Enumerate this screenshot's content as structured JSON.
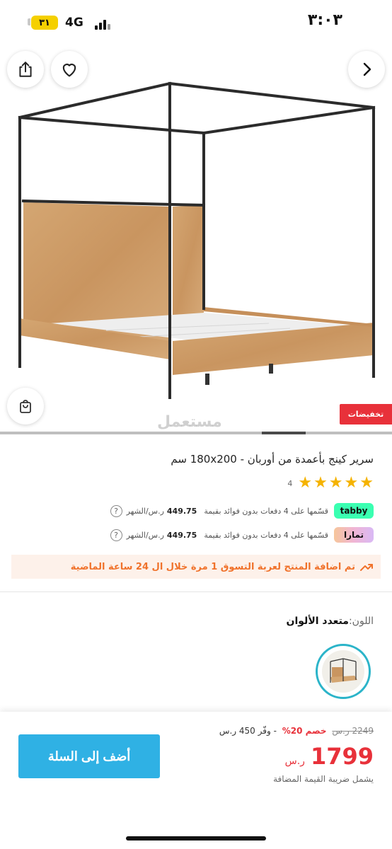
{
  "status_bar": {
    "time": "٣:٠٣",
    "battery": "٣١",
    "network": "4G"
  },
  "gallery": {
    "sale_tag": "تخفيضات",
    "watermark": "مستعمل",
    "image_position": "5 of 8",
    "icons": [
      "share-icon",
      "heart-icon",
      "chevron-right-icon",
      "cart-icon"
    ]
  },
  "product": {
    "title": "سرير كينج بأعمدة من أوربان - 180x200 سم",
    "rating": 5,
    "rating_count": "4",
    "tabby": {
      "badge": "tabby",
      "text": "قسّمها على 4 دفعات بدون فوائد بقيمة",
      "amount": "449.75",
      "unit": "ر.س/الشهر"
    },
    "tamara": {
      "badge": "تمارا",
      "text": "قسّمها على 4 دفعات بدون فوائد بقيمة",
      "amount": "449.75",
      "unit": "ر.س/الشهر"
    },
    "notice": "تم اضافة المنتج لعربة التسوق 1 مرة خلال ال 24 ساعة الماضية",
    "color_label": "اللون:",
    "color_value": "متعدد الألوان"
  },
  "purchase": {
    "old_price": "2249 ر.س",
    "discount": "خصم 20%",
    "saving": "- وفّر 450 ر.س",
    "price": "1799",
    "currency": "ر.س",
    "vat_note": "يشمل ضريبة القيمة المضافة",
    "add_to_cart": "أضف إلى السلة"
  },
  "colors": {
    "accent": "#2fb1e4",
    "sale_red": "#e8313a",
    "star": "#f5b300",
    "notice_orange": "#f0722b",
    "tabby_green": "#3affb1"
  }
}
